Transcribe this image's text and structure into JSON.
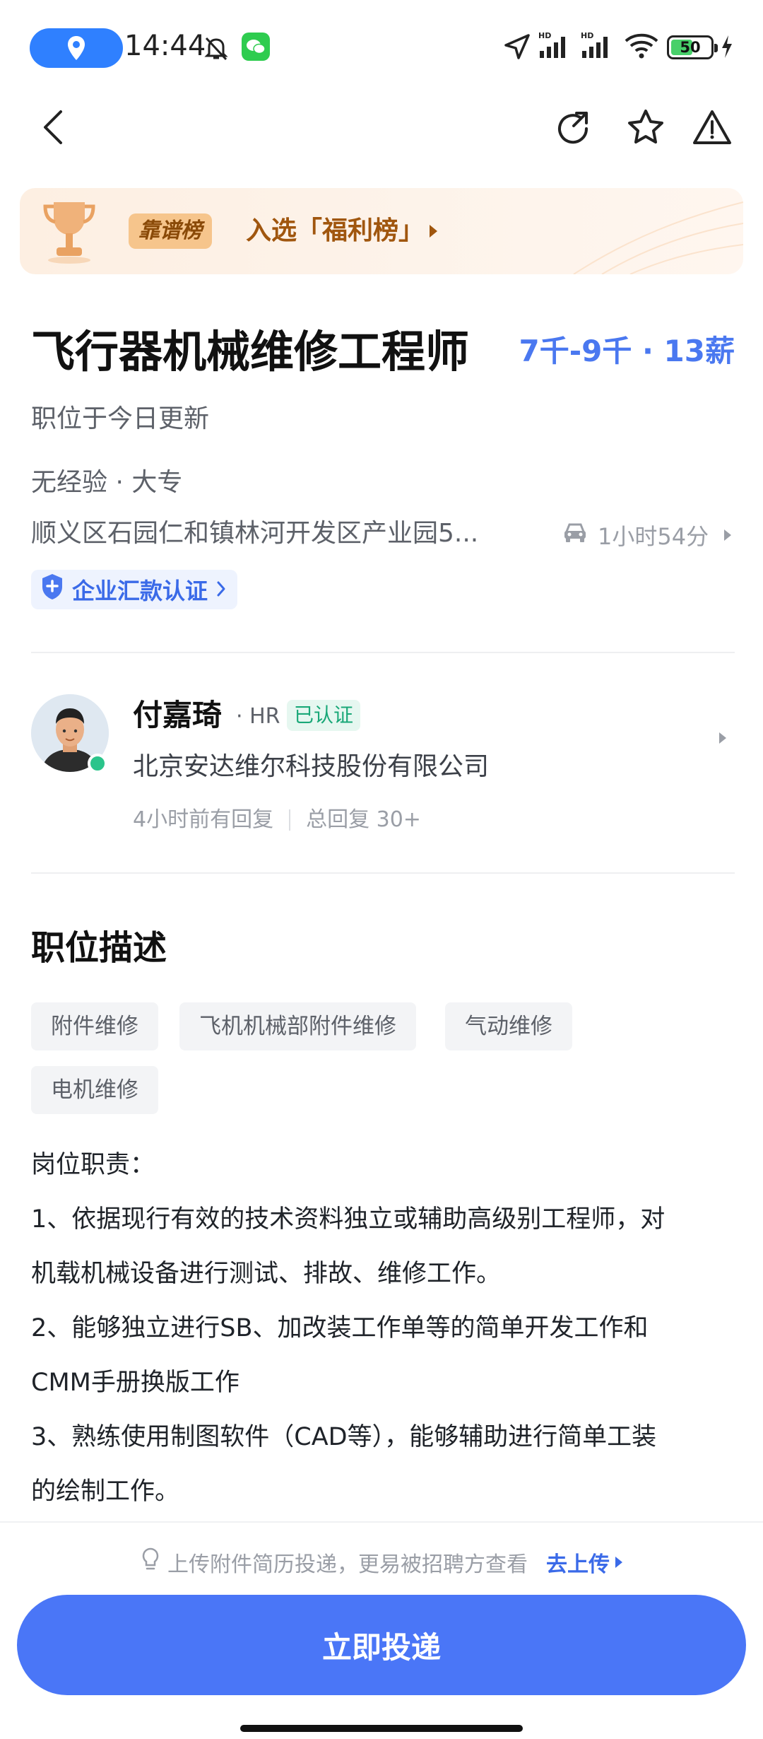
{
  "status_bar": {
    "time": "14:44",
    "network_label": "HD",
    "battery_level": "50",
    "icons": [
      "location-pill-icon",
      "mute-icon",
      "wechat-icon",
      "navigation-icon",
      "signal-icon",
      "wifi-icon",
      "battery-icon",
      "charging-icon"
    ]
  },
  "nav": {
    "icons": [
      "back-icon",
      "share-icon",
      "star-icon",
      "report-icon"
    ]
  },
  "banner": {
    "tag": "靠谱榜",
    "text": "入选「福利榜」"
  },
  "job": {
    "title": "飞行器机械维修工程师",
    "salary": "7千-9千 · 13薪",
    "updated": "职位于今日更新",
    "requirements": "无经验 · 大专",
    "address": "顺义区石园仁和镇林河开发区产业园5...",
    "commute": "1小时54分",
    "verification": "企业汇款认证"
  },
  "recruiter": {
    "name": "付嘉琦",
    "role": "· HR",
    "badge": "已认证",
    "company": "北京安达维尔科技股份有限公司",
    "reply_time": "4小时前有回复",
    "total_replies": "总回复 30+"
  },
  "description": {
    "title": "职位描述",
    "tags": [
      "附件维修",
      "飞机机械部附件维修",
      "气动维修",
      "电机维修"
    ],
    "lines": [
      "岗位职责：",
      "1、依据现行有效的技术资料独立或辅助高级别工程师，对",
      "机载机械设备进行测试、排故、维修工作。",
      "2、能够独立进行SB、加改装工作单等的简单开发工作和",
      "CMM手册换版工作",
      "3、熟练使用制图软件（CAD等），能够辅助进行简单工装",
      "的绘制工作。"
    ]
  },
  "bottom": {
    "hint": "上传附件简历投递，更易被招聘方查看",
    "upload_link": "去上传",
    "apply_button": "立即投递"
  },
  "colors": {
    "accent": "#4a76f7",
    "salary": "#4a78f0",
    "banner_text": "#a0560e",
    "verified_green": "#1aa878"
  }
}
